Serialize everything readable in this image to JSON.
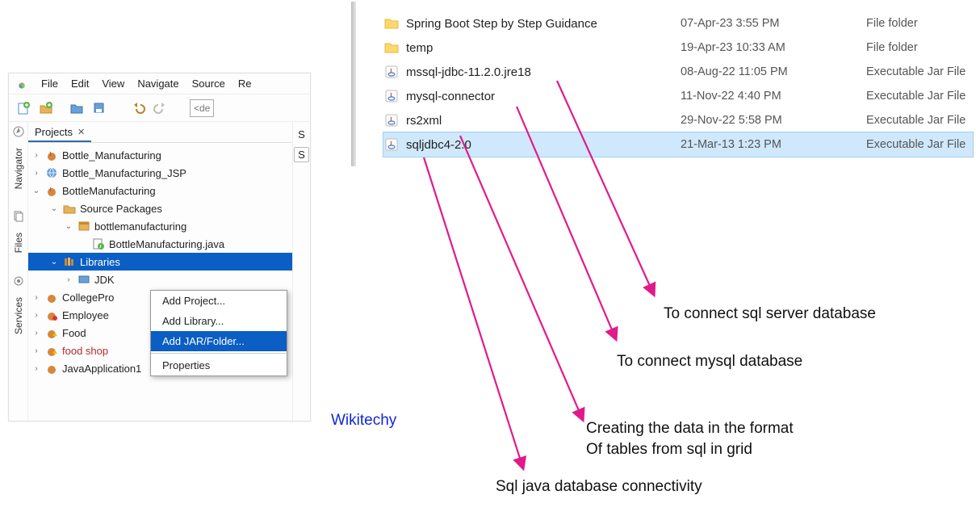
{
  "ide": {
    "menus": [
      "File",
      "Edit",
      "View",
      "Navigate",
      "Source",
      "Re"
    ],
    "combo_placeholder": "<de",
    "right_slice": [
      "S",
      "S"
    ],
    "projects_tab": "Projects",
    "tree": {
      "p1": "Bottle_Manufacturing",
      "p2": "Bottle_Manufacturing_JSP",
      "p3": "BottleManufacturing",
      "sp": "Source Packages",
      "pkg": "bottlemanufacturing",
      "java": "BottleManufacturing.java",
      "lib": "Libraries",
      "jdk": "JDK",
      "p4": "CollegePro",
      "p5": "Employee",
      "p6": "Food",
      "p7": "food shop",
      "p8": "JavaApplication1"
    },
    "side_tabs": {
      "navigator": "Navigator",
      "files": "Files",
      "services": "Services"
    }
  },
  "ctx": {
    "add_project": "Add Project...",
    "add_library": "Add Library...",
    "add_jar": "Add JAR/Folder...",
    "properties": "Properties"
  },
  "files": [
    {
      "icon": "folder",
      "name": "Spring Boot Step by Step Guidance",
      "date": "07-Apr-23 3:55 PM",
      "type": "File folder",
      "sel": false
    },
    {
      "icon": "folder",
      "name": "temp",
      "date": "19-Apr-23 10:33 AM",
      "type": "File folder",
      "sel": false
    },
    {
      "icon": "jar",
      "name": "mssql-jdbc-11.2.0.jre18",
      "date": "08-Aug-22 11:05 PM",
      "type": "Executable Jar File",
      "sel": false
    },
    {
      "icon": "jar",
      "name": "mysql-connector",
      "date": "11-Nov-22 4:40 PM",
      "type": "Executable Jar File",
      "sel": false
    },
    {
      "icon": "jar",
      "name": "rs2xml",
      "date": "29-Nov-22 5:58 PM",
      "type": "Executable Jar File",
      "sel": false
    },
    {
      "icon": "jar",
      "name": "sqljdbc4-2.0",
      "date": "21-Mar-13 1:23 PM",
      "type": "Executable Jar File",
      "sel": true
    }
  ],
  "annotations": {
    "a1": "To connect sql server database",
    "a2": "To connect mysql database",
    "a3a": "Creating the data in the format",
    "a3b": "Of tables from sql in grid",
    "a4": "Sql java database connectivity",
    "wikitechy": "Wikitechy"
  }
}
